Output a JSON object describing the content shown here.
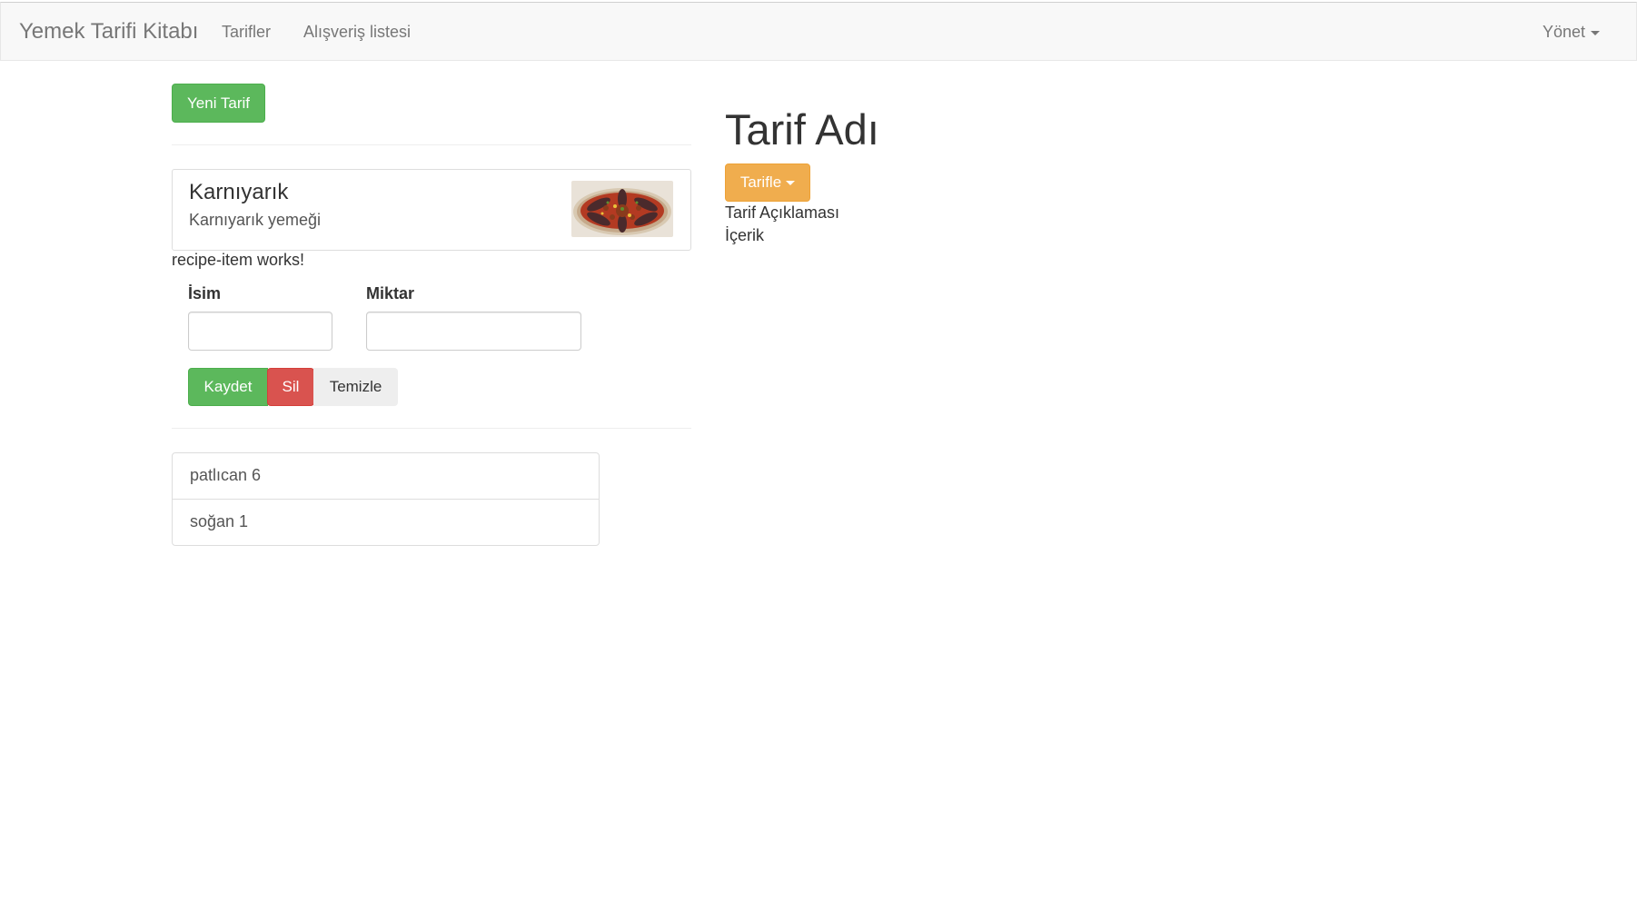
{
  "navbar": {
    "brand": "Yemek Tarifi Kitabı",
    "links": [
      "Tarifler",
      "Alışveriş listesi"
    ],
    "manage_label": "Yönet"
  },
  "recipe_list": {
    "new_button": "Yeni Tarif",
    "items": [
      {
        "name": "Karnıyarık",
        "description": "Karnıyarık yemeği",
        "image": "karniyarik-dish-photo"
      }
    ],
    "status_text": "recipe-item works!"
  },
  "ingredient_form": {
    "name_label": "İsim",
    "amount_label": "Miktar",
    "name_value": "",
    "amount_value": "",
    "save_button": "Kaydet",
    "delete_button": "Sil",
    "clear_button": "Temizle"
  },
  "ingredients": [
    {
      "text": "patlıcan 6"
    },
    {
      "text": "soğan 1"
    }
  ],
  "recipe_detail": {
    "title": "Tarif Adı",
    "action_button": "Tarifle",
    "description": "Tarif Açıklaması",
    "ingredients_label": "İçerik"
  },
  "colors": {
    "success": "#5cb85c",
    "danger": "#d9534f",
    "warning": "#f0ad4e",
    "navbar_bg": "#f8f8f8"
  }
}
